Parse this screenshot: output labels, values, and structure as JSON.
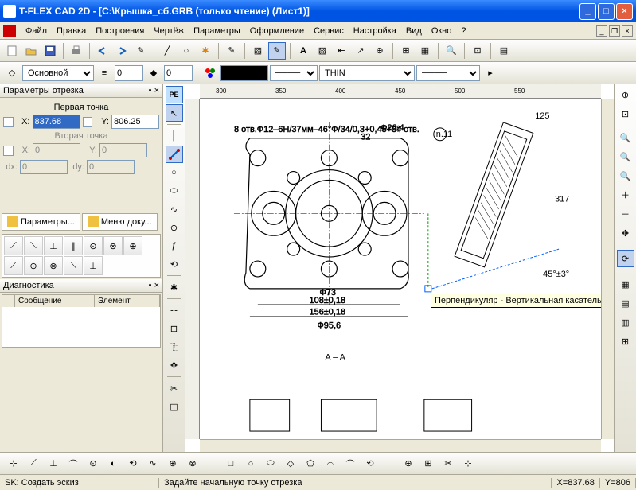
{
  "title": "T-FLEX CAD 2D - [C:\\Крышка_сб.GRB (только чтение) (Лист1)]",
  "menu": {
    "file": "Файл",
    "edit": "Правка",
    "build": "Построения",
    "draw": "Чертёж",
    "params": "Параметры",
    "format": "Оформление",
    "service": "Сервис",
    "setup": "Настройка",
    "view": "Вид",
    "window": "Окно",
    "help": "?"
  },
  "props": {
    "layer": "Основной",
    "level0": "0",
    "level1": "0",
    "linetype": "THIN"
  },
  "panel_segment": {
    "title": "Параметры отрезка",
    "pt1": "Первая точка",
    "pt2": "Вторая точка",
    "x1": "837.68",
    "y1": "806.25",
    "x2": "0",
    "y2": "0",
    "dx": "0",
    "dy": "0"
  },
  "tabs": {
    "params": "Параметры...",
    "menu": "Меню доку..."
  },
  "diag": {
    "title": "Диагностика",
    "col1": "Сообщение",
    "col2": "Элемент"
  },
  "tooltip": "Перпендикуляр - Вертикальная касательная",
  "ruler_ticks": [
    "300",
    "350",
    "400",
    "450",
    "500",
    "550"
  ],
  "drawing": {
    "section": "A – A",
    "dims": [
      "156±0,18",
      "108±0,18",
      "Ф73",
      "Ф95,6",
      "Ф26,4",
      "32",
      "125",
      "317",
      "45°±3°",
      "n.11"
    ],
    "notes": [
      "8 отв.Ф12–6Н/37мм–46°Ф/34/0,3+0,45+3°",
      "4 отв.",
      "Ф26,4"
    ]
  },
  "status": {
    "left": "SK: Создать эскиз",
    "mid": "Задайте начальную точку отрезка",
    "x": "X=837.68",
    "y": "Y=806"
  }
}
